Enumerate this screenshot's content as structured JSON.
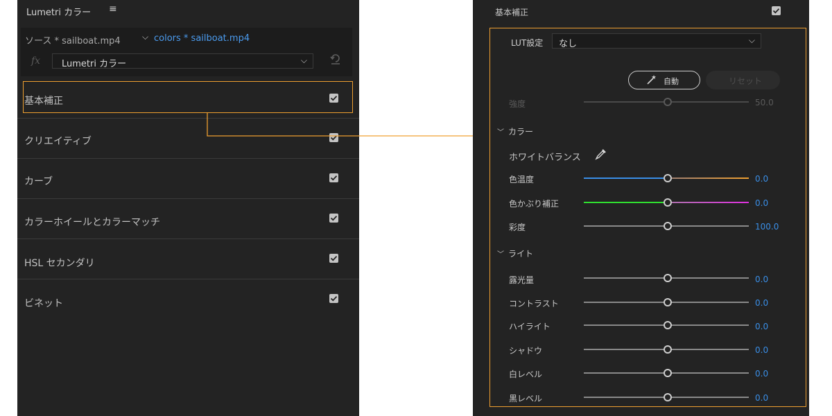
{
  "left_panel": {
    "title": "Lumetri カラー",
    "menu_icon": "hamburger-icon",
    "source": {
      "label": "ソース * sailboat.mp4",
      "clip_label": "colors * sailboat.mp4"
    },
    "effect": {
      "fx_symbol": "fx",
      "selected": "Lumetri カラー"
    },
    "sections": [
      {
        "label": "基本補正",
        "checked": true
      },
      {
        "label": "クリエイティブ",
        "checked": true
      },
      {
        "label": "カーブ",
        "checked": true
      },
      {
        "label": "カラーホイールとカラーマッチ",
        "checked": true
      },
      {
        "label": "HSL セカンダリ",
        "checked": true
      },
      {
        "label": "ビネット",
        "checked": true
      }
    ]
  },
  "right_panel": {
    "title": "基本補正",
    "title_checked": true,
    "lut": {
      "label": "LUT設定",
      "value": "なし"
    },
    "auto_button": "自動",
    "reset_button": "リセット",
    "intensity": {
      "label": "強度",
      "value": "50.0"
    },
    "color_group": {
      "title": "カラー",
      "white_balance_label": "ホワイトバランス",
      "rows": [
        {
          "label": "色温度",
          "value": "0.0"
        },
        {
          "label": "色かぶり補正",
          "value": "0.0"
        },
        {
          "label": "彩度",
          "value": "100.0"
        }
      ]
    },
    "light_group": {
      "title": "ライト",
      "rows": [
        {
          "label": "露光量",
          "value": "0.0"
        },
        {
          "label": "コントラスト",
          "value": "0.0"
        },
        {
          "label": "ハイライト",
          "value": "0.0"
        },
        {
          "label": "シャドウ",
          "value": "0.0"
        },
        {
          "label": "白レベル",
          "value": "0.0"
        },
        {
          "label": "黒レベル",
          "value": "0.0"
        }
      ]
    }
  },
  "colors": {
    "highlight": "#f0a030",
    "accent_blue": "#3a8fe8",
    "panel_bg": "#232323"
  }
}
